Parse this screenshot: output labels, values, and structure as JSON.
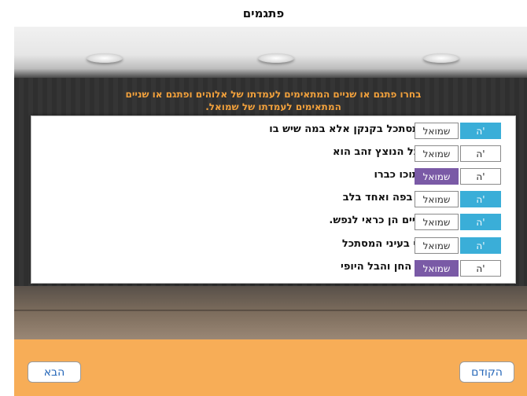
{
  "window": {
    "title": "פתגמים"
  },
  "instructions": "בחרו פתגם או שניים המתאימים לעמדתו של אלוהים  ופתגם או שניים המתאימים לעמדתו של שמואל.",
  "options": {
    "h_label": "ה'",
    "s_label": "שמואל"
  },
  "proverbs": [
    {
      "text": "אל תסתכל בקנקן אלא במה שיש בו",
      "selected": "h"
    },
    {
      "text": "לא כל הנוצץ זהב הוא",
      "selected": "none"
    },
    {
      "text": "אין תוכו כברו",
      "selected": "s"
    },
    {
      "text": "אחד בפה ואחד בלב",
      "selected": "h"
    },
    {
      "text": "העיניים הן כראי לנפש.",
      "selected": "h"
    },
    {
      "text": "היופי בעיני המסתכל",
      "selected": "h"
    },
    {
      "text": "שקר החן והבל היופי",
      "selected": "s"
    }
  ],
  "nav": {
    "next_label": "הבא",
    "prev_label": "הקודם"
  },
  "colors": {
    "accent_blue": "#3aaed8",
    "accent_purple": "#7a5aa6",
    "bottom_bar": "#f7ad57",
    "instruction_text": "#f2a13c"
  }
}
